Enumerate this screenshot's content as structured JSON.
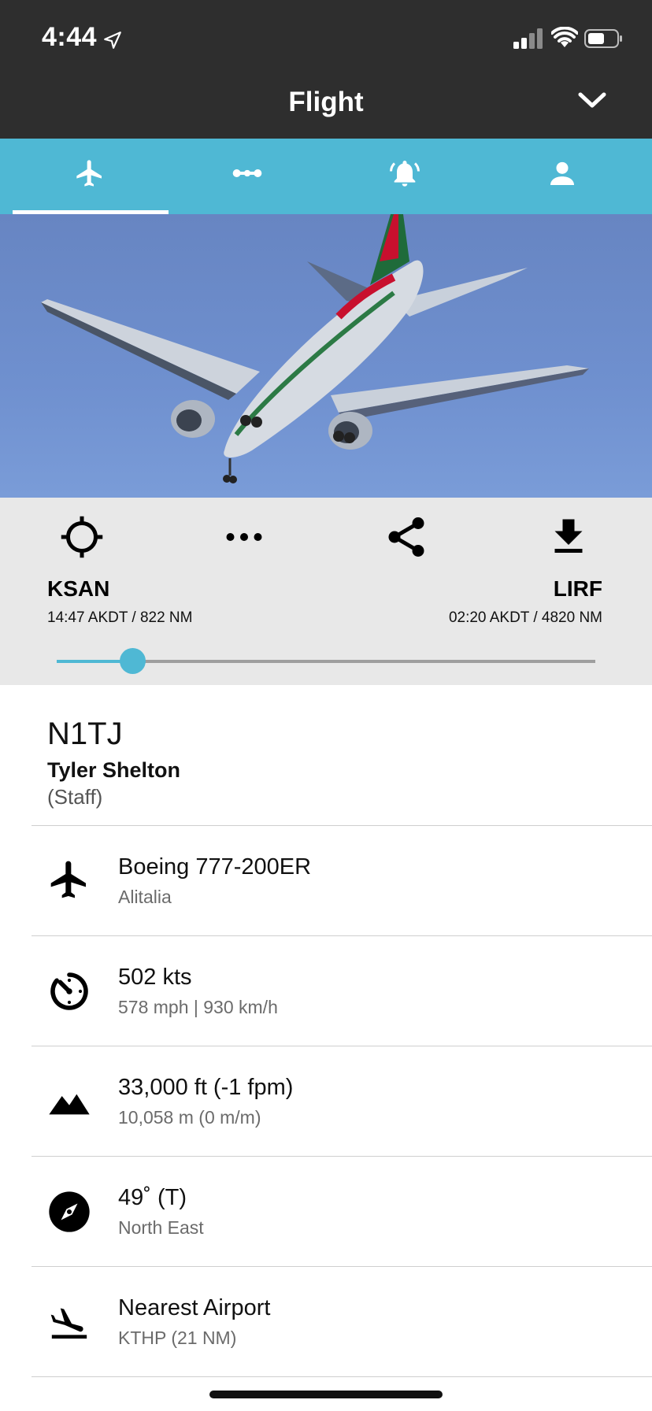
{
  "status_bar": {
    "time": "4:44"
  },
  "header": {
    "title": "Flight"
  },
  "tabs": [
    {
      "icon": "airplane-icon",
      "active": true
    },
    {
      "icon": "route-icon",
      "active": false
    },
    {
      "icon": "alert-bell-icon",
      "active": false
    },
    {
      "icon": "person-icon",
      "active": false
    }
  ],
  "route": {
    "origin": {
      "code": "KSAN",
      "info": "14:47 AKDT / 822 NM"
    },
    "destination": {
      "code": "LIRF",
      "info": "02:20 AKDT / 4820 NM"
    },
    "progress": 0.14,
    "actions": [
      "locate-icon",
      "more-icon",
      "share-icon",
      "download-icon"
    ]
  },
  "flight": {
    "ident": "N1TJ",
    "pilot": "Tyler Shelton",
    "role": "(Staff)"
  },
  "details": [
    {
      "icon": "airplane-icon",
      "main": "Boeing 777-200ER",
      "sub": "Alitalia"
    },
    {
      "icon": "speed-icon",
      "main": "502 kts",
      "sub": "578 mph | 930 km/h"
    },
    {
      "icon": "mountain-icon",
      "main": "33,000 ft (-1 fpm)",
      "sub": "10,058 m (0 m/m)"
    },
    {
      "icon": "compass-icon",
      "main": "49˚ (T)",
      "sub": "North East"
    },
    {
      "icon": "landing-icon",
      "main": "Nearest Airport",
      "sub": "KTHP (21 NM)"
    }
  ],
  "colors": {
    "accent": "#4fb8d4",
    "header_bg": "#2e2e2e",
    "panel_bg": "#e8e8e8"
  }
}
